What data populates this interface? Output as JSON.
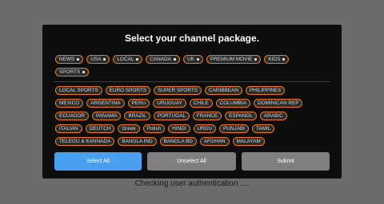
{
  "dialog": {
    "title": "Select your channel package.",
    "primary_packages": [
      {
        "label": "NEWS"
      },
      {
        "label": "USA"
      },
      {
        "label": "LOCAL"
      },
      {
        "label": "CANADA"
      },
      {
        "label": "UK"
      },
      {
        "label": "PREMIUM MOVIE"
      },
      {
        "label": "KIDS"
      },
      {
        "label": "SPORTS"
      }
    ],
    "secondary_packages": [
      [
        "LOCAL SPORTS",
        "EURO SPORTS",
        "SUPER SPORTS",
        "CARIBBEAN",
        "PHILIPPINES"
      ],
      [
        "MEXICO",
        "ARGENTINA",
        "PERU",
        "URUGUAY",
        "CHILE",
        "COLUMBIA",
        "DOMINICAN REP"
      ],
      [
        "ECUADOR",
        "PANAMA",
        "BRAZIL",
        "PORTUGAL",
        "FRANCE",
        "ESPANOL",
        "ARABIC"
      ],
      [
        "ITALIAN",
        "DEUTCH",
        "Greek",
        "Polish",
        "HINDI",
        "URDU",
        "PUNJABI",
        "TAMIL"
      ],
      [
        "TELEGU & KANNADA",
        "BANGLA IND",
        "BANGLA BD",
        "AFGHAN",
        "MALAYAM"
      ]
    ],
    "buttons": {
      "select_all": "Select All",
      "unselect_all": "Unselect All",
      "submit": "Submit"
    }
  },
  "status_text": "Checking user authentication ....",
  "colors": {
    "accent": "#f07a1a",
    "primary_button": "#4aa0f0",
    "secondary_button": "#7f7f7f",
    "dialog_bg": "#0d0d0d",
    "backdrop": "#6b6b6b"
  }
}
